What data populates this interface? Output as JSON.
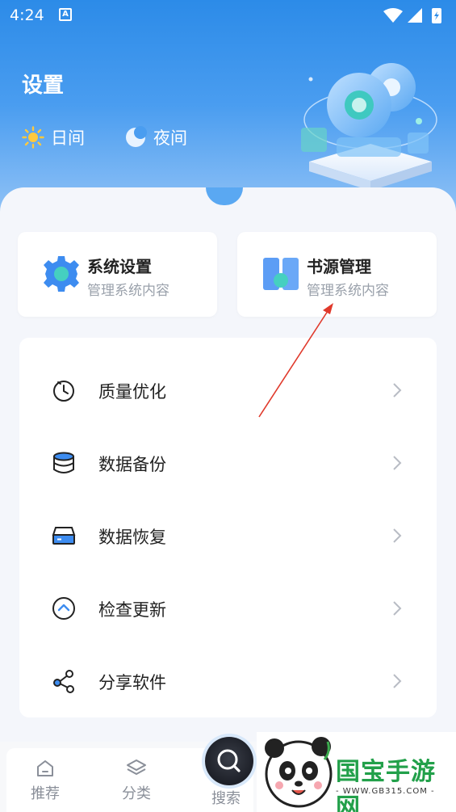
{
  "status_bar": {
    "time": "4:24",
    "notification_badge": "A"
  },
  "header": {
    "title": "设置",
    "day_mode_label": "日间",
    "night_mode_label": "夜间"
  },
  "cards": [
    {
      "title": "系统设置",
      "subtitle": "管理系统内容",
      "icon": "gear-icon"
    },
    {
      "title": "书源管理",
      "subtitle": "管理系统内容",
      "icon": "book-icon"
    }
  ],
  "menu": [
    {
      "label": "质量优化",
      "icon": "timer-icon"
    },
    {
      "label": "数据备份",
      "icon": "database-icon"
    },
    {
      "label": "数据恢复",
      "icon": "server-icon"
    },
    {
      "label": "检查更新",
      "icon": "arrow-up-circle-icon"
    },
    {
      "label": "分享软件",
      "icon": "share-icon"
    }
  ],
  "tabbar": {
    "recommend": "推荐",
    "category": "分类",
    "search": "搜索"
  },
  "watermark": {
    "name": "国宝手游网",
    "url": "- WWW.GB315.COM -"
  },
  "colors": {
    "header_top": "#2c8be8",
    "header_bottom": "#9ec9f7",
    "accent_green": "#22a04a",
    "annotation_arrow": "#e0392b"
  }
}
